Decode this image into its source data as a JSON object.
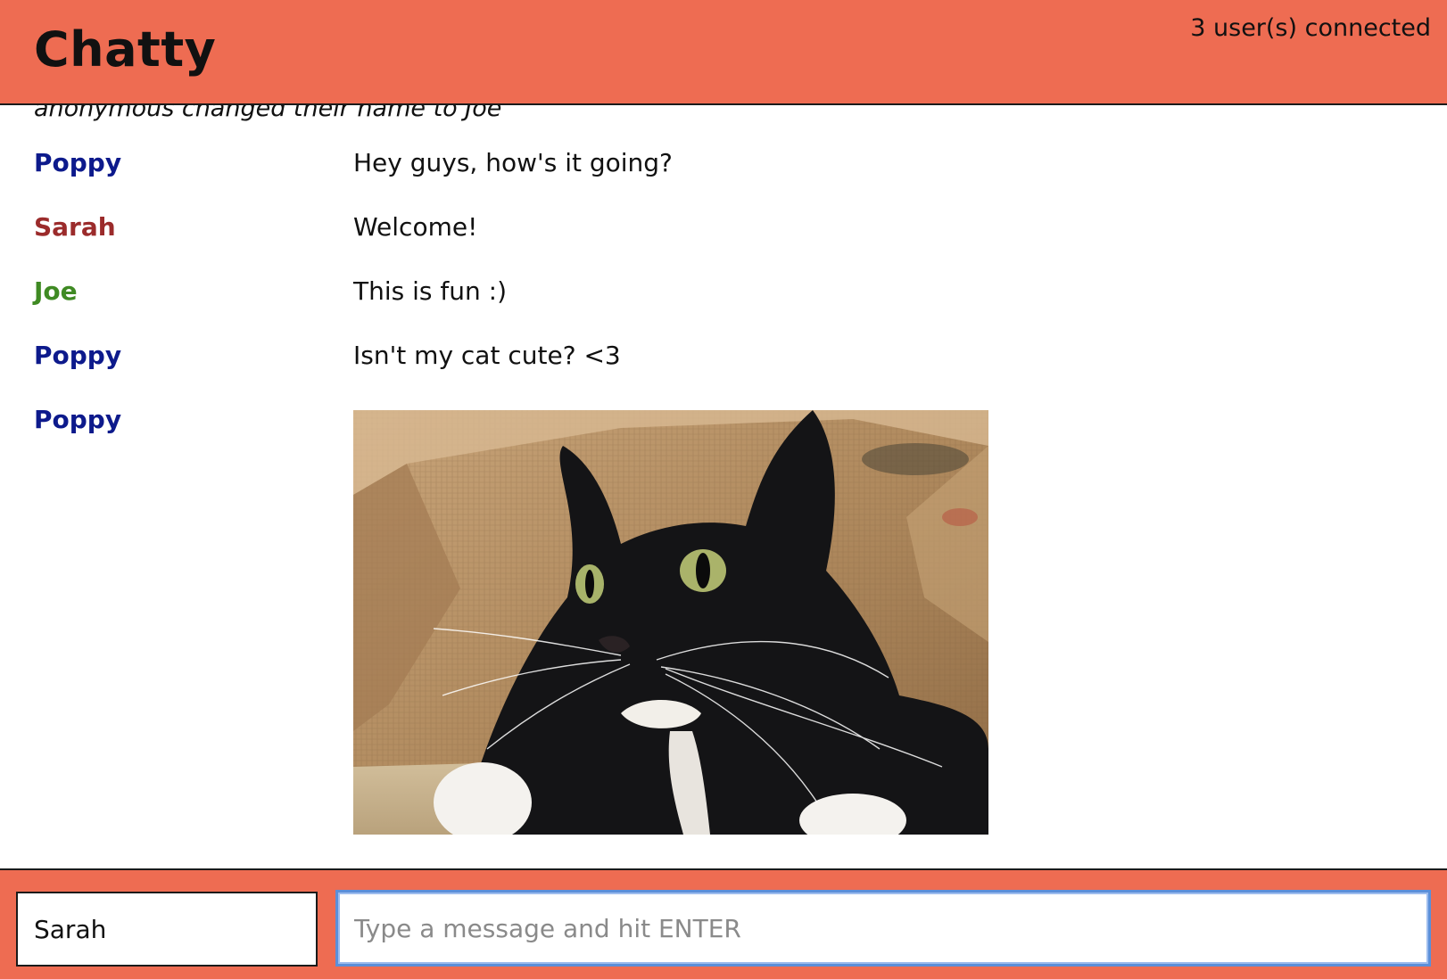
{
  "navbar": {
    "brand": "Chatty",
    "user_count": "3 user(s) connected"
  },
  "notification": "anonymous changed their name to Joe",
  "messages": [
    {
      "username": "Poppy",
      "content": "Hey guys, how's it going?",
      "color": "#0d1a8c"
    },
    {
      "username": "Sarah",
      "content": "Welcome!",
      "color": "#9b2b2b"
    },
    {
      "username": "Joe",
      "content": "This is fun :)",
      "color": "#3f8a23"
    },
    {
      "username": "Poppy",
      "content": "Isn't my cat cute? <3",
      "color": "#0d1a8c"
    },
    {
      "username": "Poppy",
      "content": "",
      "color": "#0d1a8c",
      "image": "cat photo"
    }
  ],
  "composer": {
    "username_value": "Sarah",
    "message_placeholder": "Type a message and hit ENTER",
    "message_value": ""
  },
  "colors": {
    "accent": "#ee6c52",
    "focus_ring": "#5b8fd9"
  }
}
